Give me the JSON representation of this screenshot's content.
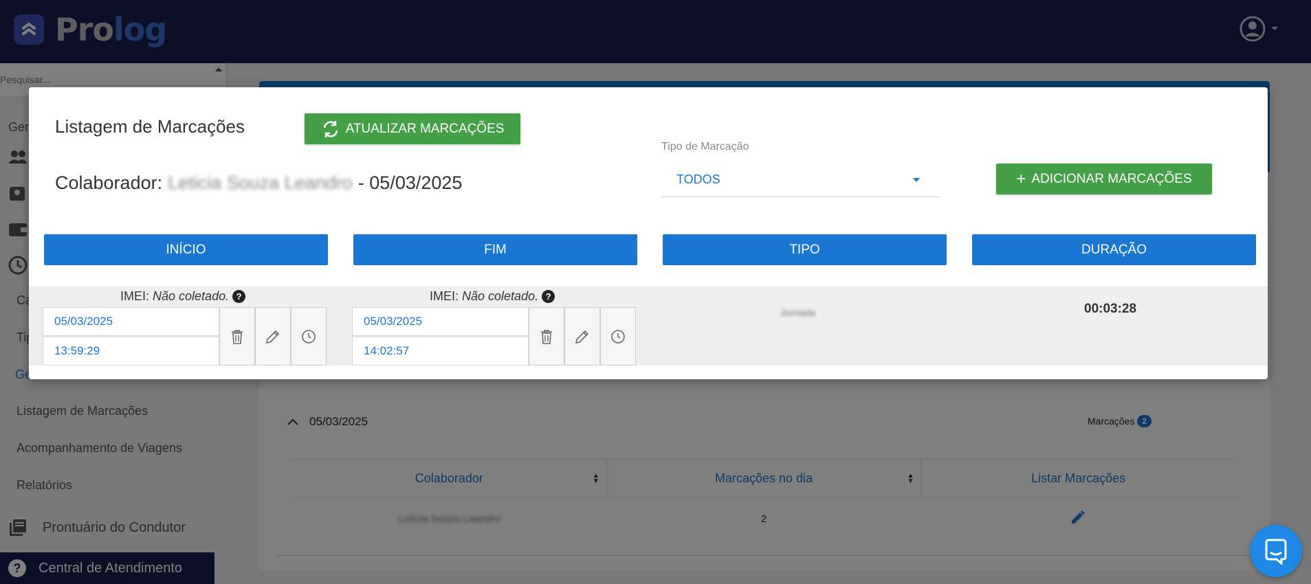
{
  "app": {
    "brand_pro": "Pro",
    "brand_log": "log",
    "colors": {
      "navy": "#1b1f4e",
      "primary": "#1976d2",
      "green": "#43a047"
    }
  },
  "sidebar": {
    "search_placeholder": "Pesquisar...",
    "group_fragment": "Ger",
    "sub_ca": "Ca",
    "sub_ti": "Tip",
    "sub_ge": "Ge",
    "items": [
      {
        "label": "Listagem de Marcações"
      },
      {
        "label": "Acompanhamento de Viagens"
      },
      {
        "label": "Relatórios"
      }
    ],
    "prontuario": "Prontuário do Condutor",
    "central": "Central de Atendimento"
  },
  "background": {
    "group_date": "05/03/2025",
    "marcacoes_label": "Marcações",
    "marcacoes_count": "2",
    "table": {
      "headers": [
        "Colaborador",
        "Marcações no dia",
        "Listar Marcações"
      ],
      "rows": [
        {
          "colaborador": "Leticia Souza Leandro",
          "marcacoes": "2"
        }
      ]
    }
  },
  "modal": {
    "title": "Listagem de Marcações",
    "refresh_label": "ATUALIZAR MARCAÇÕES",
    "collab_prefix": "Colaborador:",
    "collab_name": "Leticia Souza Leandro",
    "collab_date": "- 05/03/2025",
    "tipo_label": "Tipo de Marcação",
    "tipo_value": "TODOS",
    "add_label": "ADICIONAR MARCAÇÕES",
    "columns": [
      "INÍCIO",
      "FIM",
      "TIPO",
      "DURAÇÃO"
    ],
    "row": {
      "imei_label": "IMEI:",
      "imei_value": "Não coletado.",
      "help": "?",
      "inicio_date": "05/03/2025",
      "inicio_time": "13:59:29",
      "fim_date": "05/03/2025",
      "fim_time": "14:02:57",
      "tipo": "Jornada",
      "duracao": "00:03:28"
    }
  }
}
